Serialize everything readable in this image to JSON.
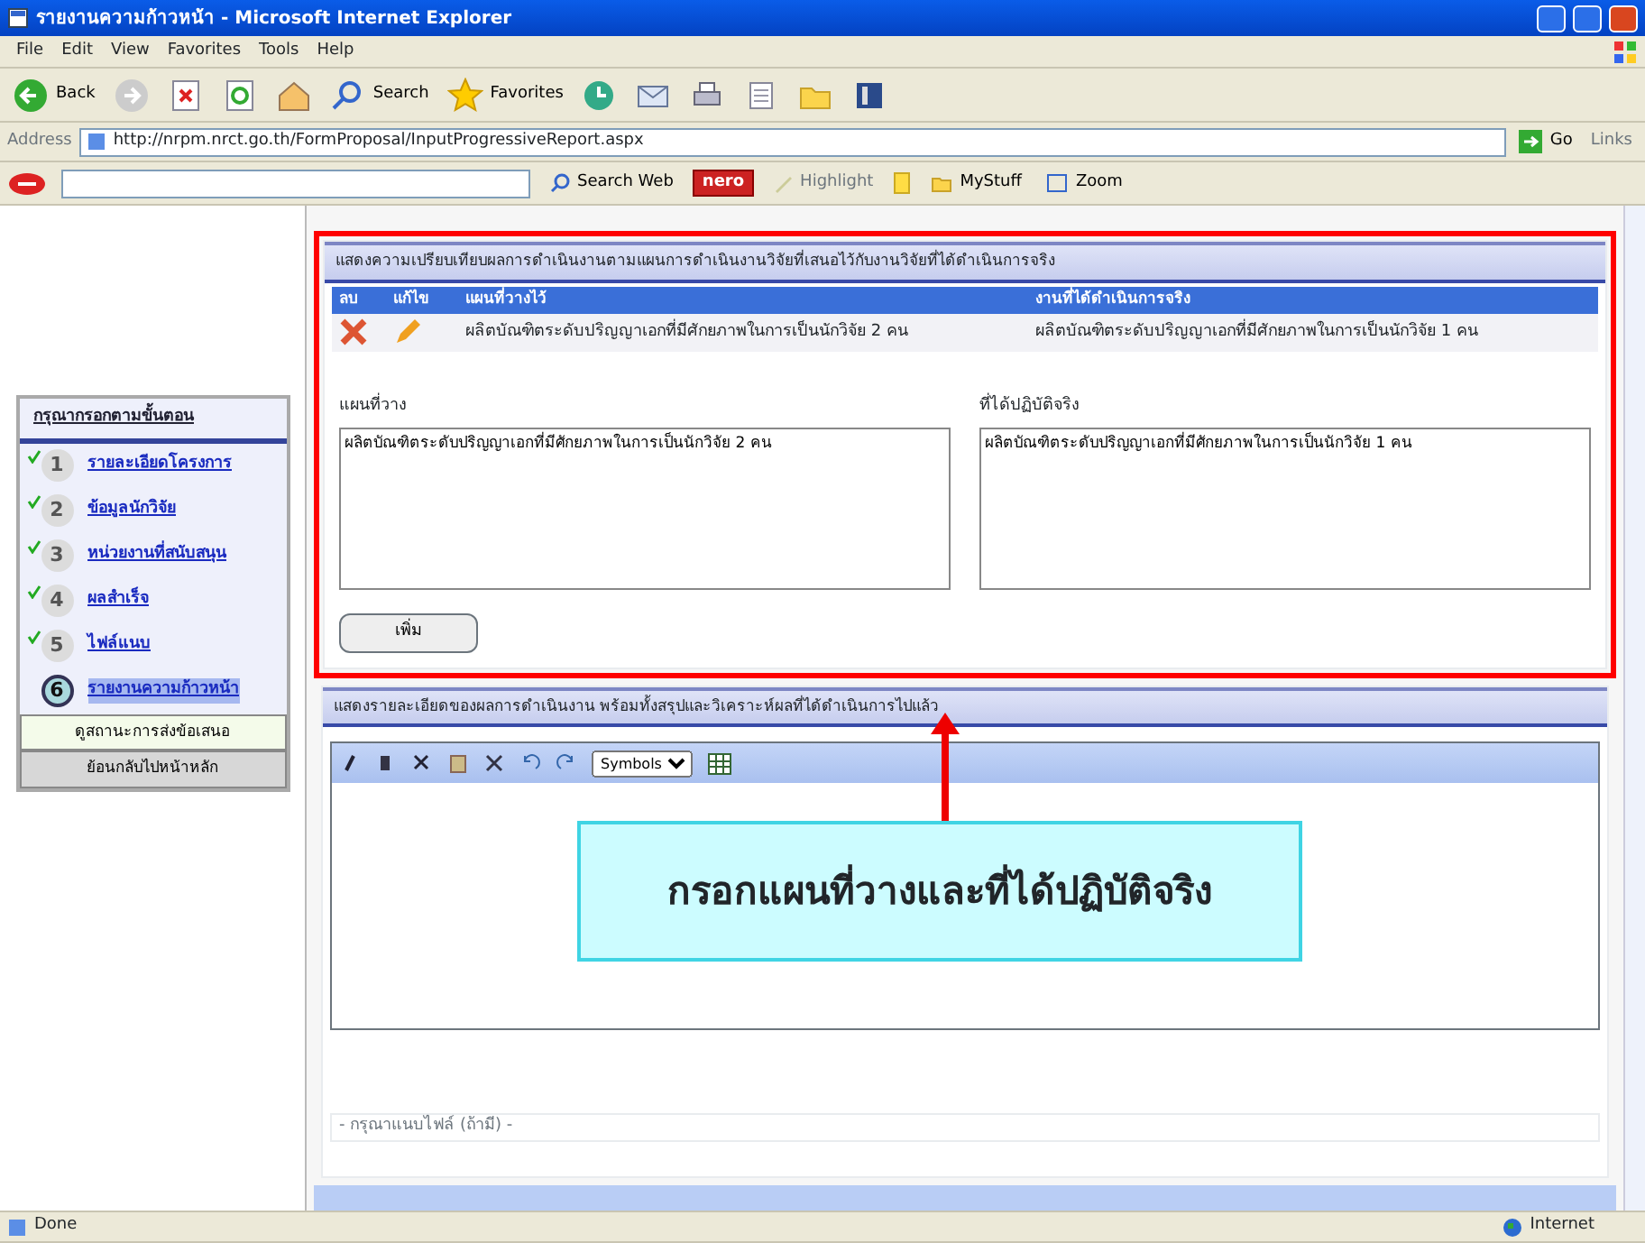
{
  "window": {
    "title": "รายงานความก้าวหน้า - Microsoft Internet Explorer"
  },
  "menu": [
    "File",
    "Edit",
    "View",
    "Favorites",
    "Tools",
    "Help"
  ],
  "toolbar": [
    {
      "kind": "back",
      "label": "Back"
    },
    {
      "kind": "forward"
    },
    {
      "kind": "stop"
    },
    {
      "kind": "refresh"
    },
    {
      "kind": "home"
    },
    {
      "kind": "search",
      "label": "Search"
    },
    {
      "kind": "favorites",
      "label": "Favorites"
    },
    {
      "kind": "history"
    },
    {
      "kind": "mail"
    },
    {
      "kind": "print"
    },
    {
      "kind": "edit"
    },
    {
      "kind": "folder"
    },
    {
      "kind": "book"
    }
  ],
  "address": {
    "label": "Address",
    "url": "http://nrpm.nrct.go.th/FormProposal/InputProgressiveReport.aspx",
    "go": "Go",
    "links": "Links"
  },
  "search_bar": {
    "search_web": "Search Web",
    "nero": "nero",
    "highlight": "Highlight",
    "mystuff": "MyStuff",
    "zoom": "Zoom"
  },
  "sidebar": {
    "heading": "กรุณากรอกตามขั้นตอน",
    "steps": [
      {
        "number": "1",
        "label": "รายละเอียดโครงการ",
        "done": true,
        "selected": false
      },
      {
        "number": "2",
        "label": "ข้อมูลนักวิจัย",
        "done": true,
        "selected": false
      },
      {
        "number": "3",
        "label": "หน่วยงานที่สนับสนุน",
        "done": true,
        "selected": false
      },
      {
        "number": "4",
        "label": "ผลสำเร็จ",
        "done": true,
        "selected": false
      },
      {
        "number": "5",
        "label": "ไฟล์แนบ",
        "done": true,
        "selected": false
      },
      {
        "number": "6",
        "label": "รายงานความก้าวหน้า",
        "done": false,
        "selected": true
      }
    ],
    "buttons": [
      "ดูสถานะการส่งข้อเสนอ",
      "ย้อนกลับไปหน้าหลัก"
    ]
  },
  "plan_section": {
    "title": "แสดงความเปรียบเทียบผลการดำเนินงานตามแผนการดำเนินงานวิจัยที่เสนอไว้กับงานวิจัยที่ได้ดำเนินการจริง",
    "columns": [
      "ลบ",
      "แก้ไข",
      "แผนที่วางไว้",
      "งานที่ได้ดำเนินการจริง"
    ],
    "rows": [
      {
        "plan": "ผลิตบัณฑิตระดับปริญญาเอกที่มีศักยภาพในการเป็นนักวิจัย 2 คน",
        "actual": "ผลิตบัณฑิตระดับปริญญาเอกที่มีศักยภาพในการเป็นนักวิจัย 1 คน"
      }
    ],
    "plan_label": "แผนที่วาง",
    "plan_value": "ผลิตบัณฑิตระดับปริญญาเอกที่มีศักยภาพในการเป็นนักวิจัย 2 คน",
    "actual_label": "ที่ได้ปฏิบัติจริง",
    "actual_value": "ผลิตบัณฑิตระดับปริญญาเอกที่มีศักยภาพในการเป็นนักวิจัย 1 คน",
    "add_button": "เพิ่ม"
  },
  "detail_section": {
    "title": "แสดงรายละเอียดของผลการดำเนินงาน พร้อมทั้งสรุปและวิเคราะห์ผลที่ได้ดำเนินการไปแล้ว",
    "font_select": "Symbols"
  },
  "attachment": {
    "placeholder": "- กรุณาแนบไฟล์ (ถ้ามี) -"
  },
  "annotation": {
    "text": "กรอกแผนที่วางและที่ได้ปฏิบัติจริง"
  },
  "status_bar": {
    "left": "Done",
    "zone": "Internet"
  }
}
